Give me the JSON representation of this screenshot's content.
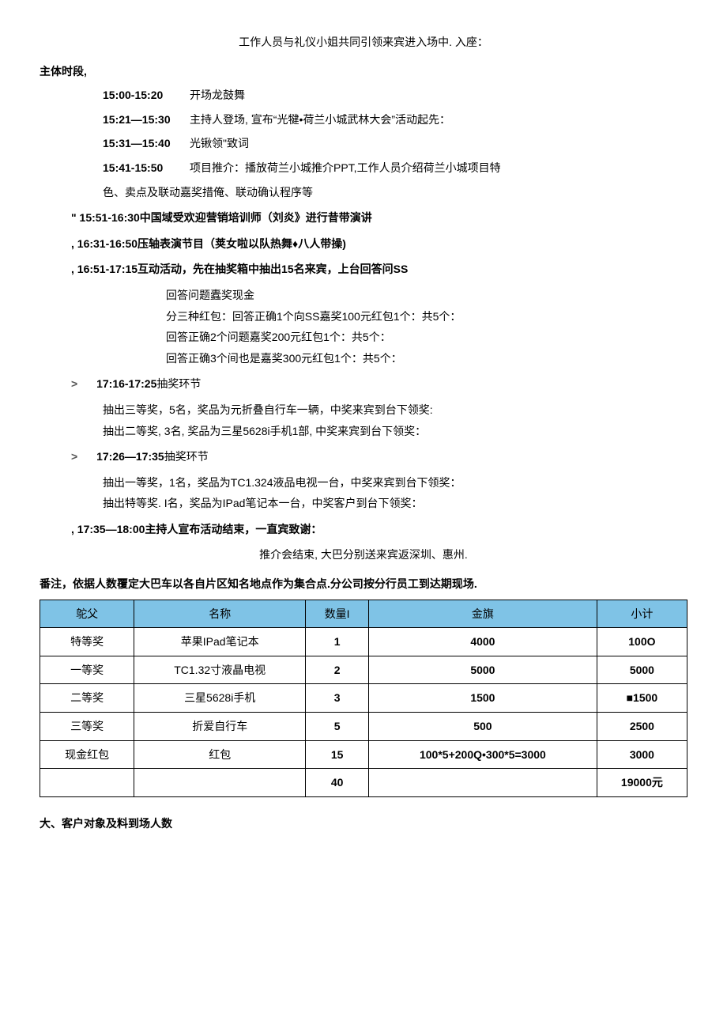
{
  "intro": "工作人员与礼仪小姐共同引领来宾进入场中. 入座：",
  "section1": "主体时段,",
  "sched": [
    {
      "time": "15:00-15:20",
      "desc": "开场龙鼓舞"
    },
    {
      "time": "15:21—15:30",
      "desc": "主持人登场, 宣布“光犍•荷兰小城武林大会”活动起先："
    },
    {
      "time": "15:31—15:40",
      "desc": "光锹领\"致词"
    },
    {
      "time": "15:41-15:50",
      "desc": "项目推介：播放荷兰小城推介PPT,工作人员介绍荷兰小城项目特"
    }
  ],
  "sched_cont": "色、卖点及联动嘉奖措俺、联动确认程序等",
  "b1": "\" 15:51-16:30中国域受欢迎营销培训师（刘炎》进行昔带演讲",
  "b2": ", 16:31-16:50压轴表演节目（荚女啦以队热舞♦八人带操)",
  "b3": ", 16:51-17:15互动活动，先在抽奖箱中抽出15名来宾，上台回答问SS",
  "ans1": "回答问题蠹奖现金",
  "ans2": "分三种红包：回答正确1个向SS嘉奖100元红包1个：共5个：",
  "ans3": "回答正确2个问题嘉奖200元红包1个：共5个：",
  "ans4": "回答正确3个间也是嘉奖300元红包1个：共5个：",
  "b4_time": "17:16-17:25",
  "b4_label": "抽奖环节",
  "b4_l1": "抽出三等奖，5名，奖品为元折叠自行车一辆，中奖来宾到台下领奖:",
  "b4_l2": "抽出二等奖, 3名, 奖品为三星5628i手机1部, 中奖来宾到台下领奖：",
  "b5_time": "17:26—17:35",
  "b5_label": "抽奖环节",
  "b5_l1": "抽出一等奖，1名，奖品为TC1.324液品电视一台，中奖来宾到台下领奖：",
  "b5_l2": "抽出特等奖. I名，奖品为IPad笔记本一台，中奖客户到台下领奖：",
  "b6": ", 17:35—18:00主持人宣布活动结束，一直宾致谢：",
  "closing": "推介会结束, 大巴分别送来宾返深圳、惠州.",
  "note": "番注，依据人数覆定大巴车以各自片区知名地点作为集合点.分公司按分行员工到达期现场.",
  "table": {
    "headers": [
      "鸵父",
      "名称",
      "数量I",
      "金旗",
      "小计"
    ],
    "rows": [
      [
        "特等奖",
        "苹果IPad笔记本",
        "1",
        "4000",
        "100O"
      ],
      [
        "一等奖",
        "TC1.32寸液晶电视",
        "2",
        "5000",
        "5000"
      ],
      [
        "二等奖",
        "三星5628i手机",
        "3",
        "1500",
        "■1500"
      ],
      [
        "三等奖",
        "折爱自行车",
        "5",
        "500",
        "2500"
      ],
      [
        "现金红包",
        "红包",
        "15",
        "100*5+200Q•300*5=3000",
        "3000"
      ]
    ],
    "total": [
      "",
      "",
      "40",
      "",
      "19000元"
    ]
  },
  "footer": "大、客户对象及料到场人数"
}
